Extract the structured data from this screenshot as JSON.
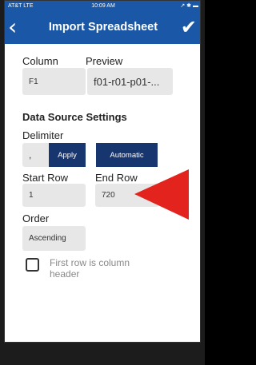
{
  "status": {
    "carrier": "AT&T  LTE",
    "time": "10:09 AM",
    "right": "↗ ✱ ▬"
  },
  "nav": {
    "title": "Import Spreadsheet"
  },
  "column": {
    "label": "Column",
    "value": "F1"
  },
  "preview": {
    "label": "Preview",
    "value": "f01-r01-p01-..."
  },
  "data_source": {
    "title": "Data Source Settings"
  },
  "delimiter": {
    "label": "Delimiter",
    "value": ",",
    "apply_label": "Apply",
    "automatic_label": "Automatic"
  },
  "start_row": {
    "label": "Start Row",
    "value": "1"
  },
  "end_row": {
    "label": "End Row",
    "value": "720"
  },
  "order": {
    "label": "Order",
    "value": "Ascending"
  },
  "header_checkbox": {
    "label": "First row is column header",
    "checked": false
  },
  "colors": {
    "navbar": "#1a57a6",
    "button": "#17356e",
    "field": "#e7e7e7",
    "arrow": "#e3241e"
  }
}
